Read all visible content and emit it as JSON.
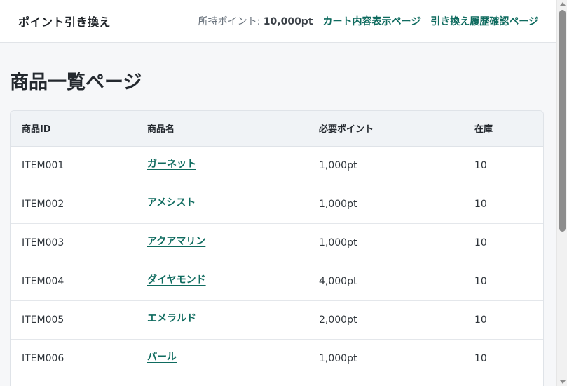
{
  "header": {
    "title": "ポイント引き換え",
    "points_label": "所持ポイント:",
    "points_value": "10,000pt",
    "links": [
      "カート内容表示ページ",
      "引き換え履歴確認ページ"
    ]
  },
  "main": {
    "title": "商品一覧ページ",
    "columns": [
      "商品ID",
      "商品名",
      "必要ポイント",
      "在庫"
    ],
    "rows": [
      {
        "id": "ITEM001",
        "name": "ガーネット",
        "points": "1,000pt",
        "stock": "10"
      },
      {
        "id": "ITEM002",
        "name": "アメシスト",
        "points": "1,000pt",
        "stock": "10"
      },
      {
        "id": "ITEM003",
        "name": "アクアマリン",
        "points": "1,000pt",
        "stock": "10"
      },
      {
        "id": "ITEM004",
        "name": "ダイヤモンド",
        "points": "4,000pt",
        "stock": "10"
      },
      {
        "id": "ITEM005",
        "name": "エメラルド",
        "points": "2,000pt",
        "stock": "10"
      },
      {
        "id": "ITEM006",
        "name": "パール",
        "points": "1,000pt",
        "stock": "10"
      }
    ]
  },
  "colors": {
    "link": "#0f6b5f",
    "header_bg": "#ffffff",
    "page_bg": "#f6f7f9",
    "table_head_bg": "#f0f3f6"
  }
}
